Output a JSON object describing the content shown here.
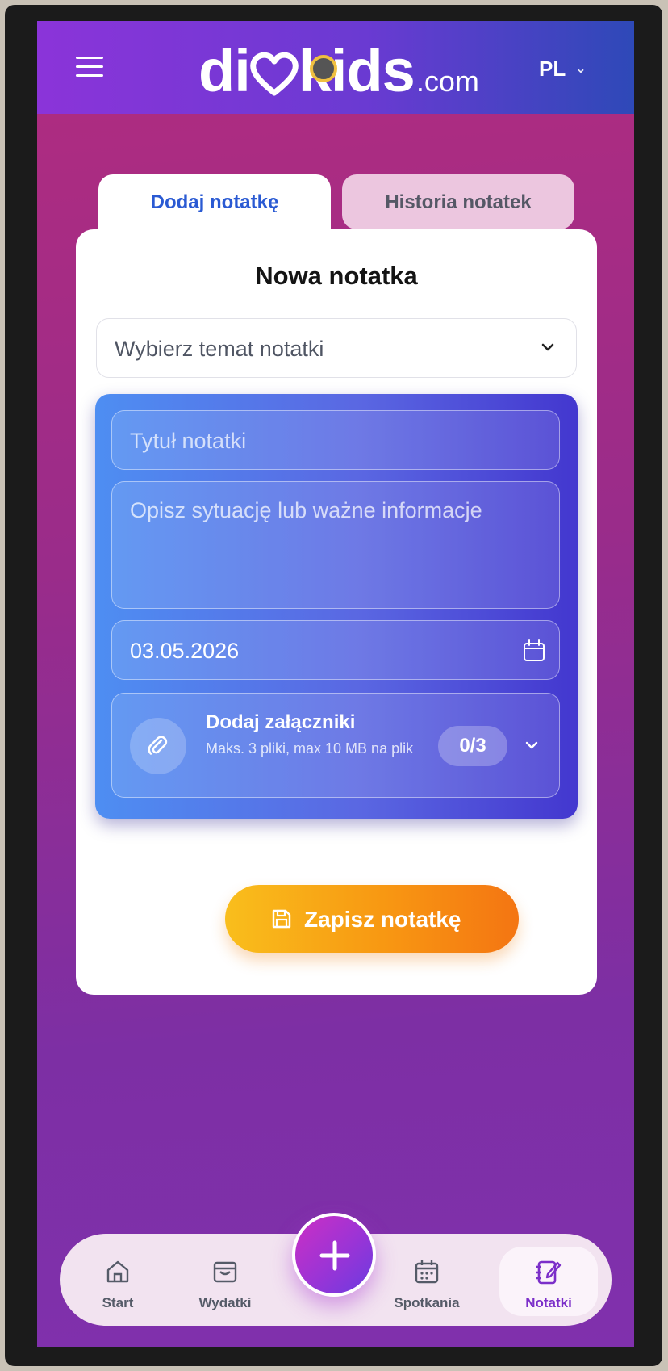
{
  "header": {
    "logo_main": "di",
    "logo_kids": "kids",
    "logo_suffix": ".com",
    "language": "PL"
  },
  "tabs": {
    "add_note": "Dodaj notatkę",
    "history": "Historia notatek"
  },
  "form": {
    "title": "Nowa notatka",
    "topic_placeholder": "Wybierz temat notatki",
    "note_title_placeholder": "Tytuł notatki",
    "description_placeholder": "Opisz sytuację lub ważne informacje",
    "date_value": "03.05.2026",
    "attachments": {
      "title": "Dodaj załączniki",
      "subtitle": "Maks. 3 pliki, max 10 MB na plik",
      "count": "0/3"
    },
    "save_label": "Zapisz notatkę"
  },
  "bottom_nav": {
    "start": "Start",
    "expenses": "Wydatki",
    "meetings": "Spotkania",
    "notes": "Notatki"
  },
  "colors": {
    "header_start": "#8b34d9",
    "header_end": "#2e49b8",
    "accent_blue": "#2a5ad3",
    "accent_purple": "#7b2ec9",
    "save_start": "#f9be1c",
    "save_end": "#f47512"
  }
}
